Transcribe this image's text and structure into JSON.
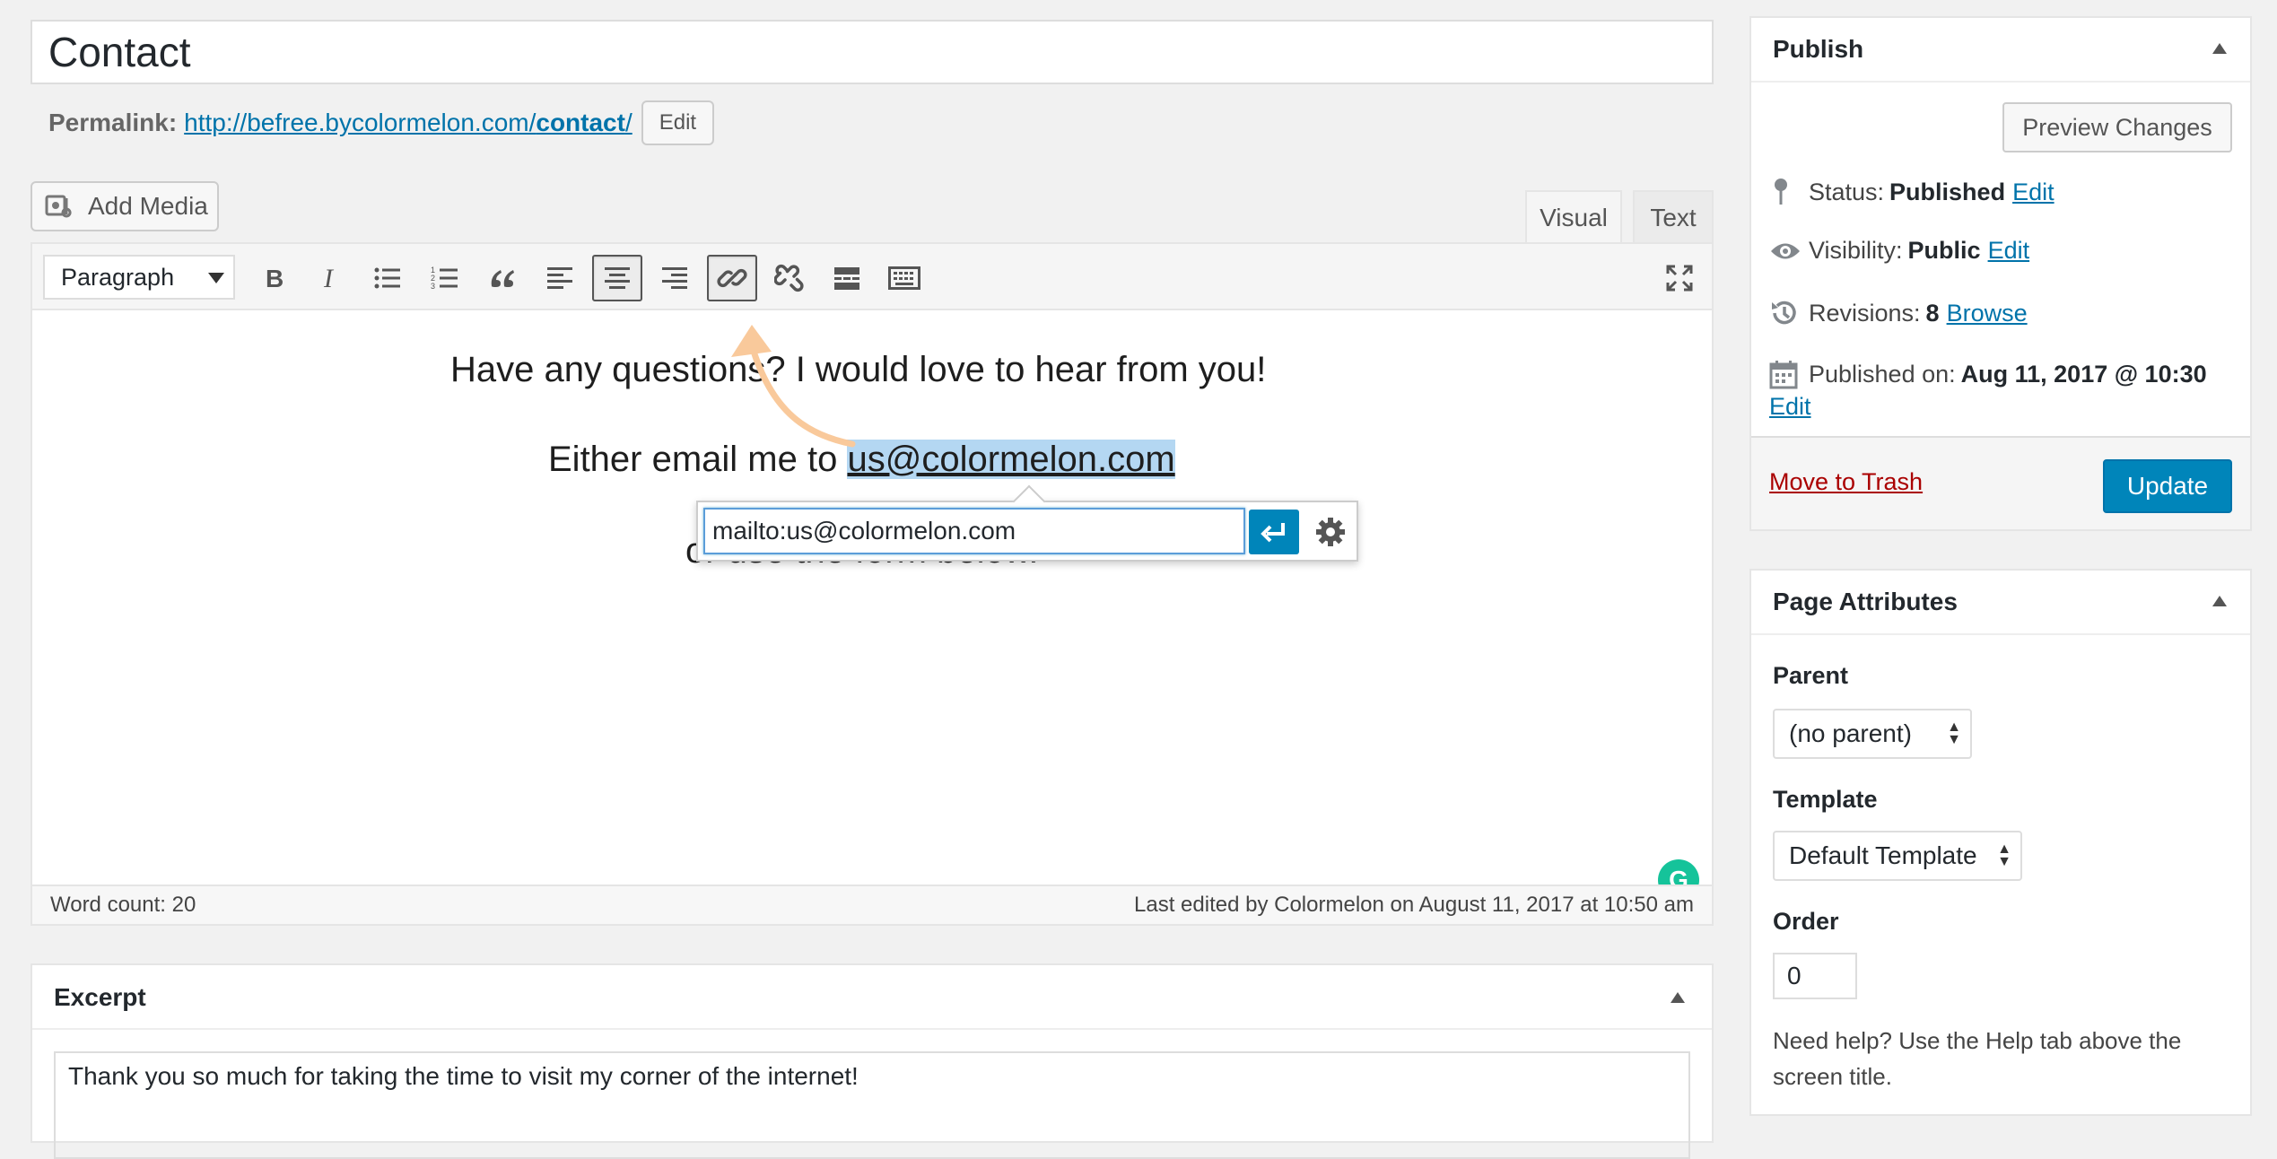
{
  "post": {
    "title": "Contact",
    "permalink_label": "Permalink:",
    "permalink_base": "http://befree.bycolormelon.com/",
    "permalink_slug": "contact",
    "permalink_tail": "/",
    "permalink_edit": "Edit"
  },
  "editor": {
    "add_media": "Add Media",
    "tab_visual": "Visual",
    "tab_text": "Text",
    "format": "Paragraph",
    "line1": "Have any questions?  I would love to hear from you!",
    "line2_prefix": "Either email me to ",
    "line2_email": "us@colormelon.com",
    "line3": "or use the form below.",
    "link_url": "mailto:us@colormelon.com",
    "grammarly_letter": "G",
    "word_count": "Word count: 20",
    "last_edited": "Last edited by Colormelon on August 11, 2017 at 10:50 am"
  },
  "excerpt": {
    "title": "Excerpt",
    "text": "Thank you so much for taking the time to visit my corner of the internet!"
  },
  "publish": {
    "title": "Publish",
    "preview": "Preview Changes",
    "status_label": "Status:",
    "status_value": "Published",
    "visibility_label": "Visibility:",
    "visibility_value": "Public",
    "revisions_label": "Revisions:",
    "revisions_value": "8",
    "browse": "Browse",
    "published_label": "Published on:",
    "published_value": "Aug 11, 2017 @ 10:30",
    "edit": "Edit",
    "trash": "Move to Trash",
    "update": "Update"
  },
  "page_attributes": {
    "title": "Page Attributes",
    "parent_label": "Parent",
    "parent_value": "(no parent)",
    "template_label": "Template",
    "template_value": "Default Template",
    "order_label": "Order",
    "order_value": "0",
    "help": "Need help? Use the Help tab above the screen title."
  },
  "colors": {
    "accent": "#0085ba",
    "link": "#0073aa",
    "trash": "#a00",
    "selection": "#b4d7f2",
    "annotation_arrow": "#f9c99b"
  }
}
